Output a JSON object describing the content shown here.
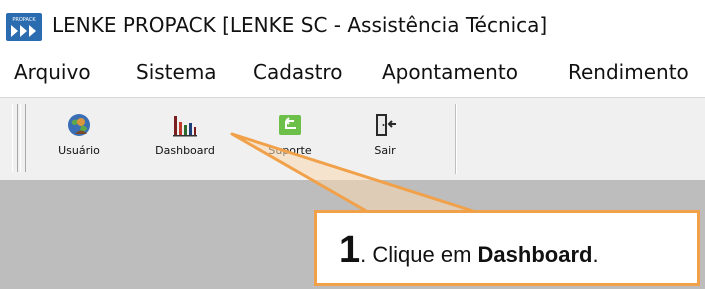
{
  "window": {
    "title": "LENKE PROPACK [LENKE SC - Assistência Técnica]",
    "icon": "propack-logo-icon",
    "icon_text": "PROPACK"
  },
  "menu": {
    "items": [
      "Arquivo",
      "Sistema",
      "Cadastro",
      "Apontamento",
      "Rendimento"
    ]
  },
  "toolbar": {
    "buttons": [
      {
        "label": "Usuário",
        "icon": "user-globe-icon"
      },
      {
        "label": "Dashboard",
        "icon": "bar-chart-icon"
      },
      {
        "label": "Suporte",
        "icon": "return-arrow-icon"
      },
      {
        "label": "Sair",
        "icon": "exit-door-icon"
      }
    ]
  },
  "callout": {
    "number": "1",
    "dot": ".",
    "text": " Clique em ",
    "strong": "Dashboard",
    "end": ".",
    "border_color": "#f0a14a"
  }
}
